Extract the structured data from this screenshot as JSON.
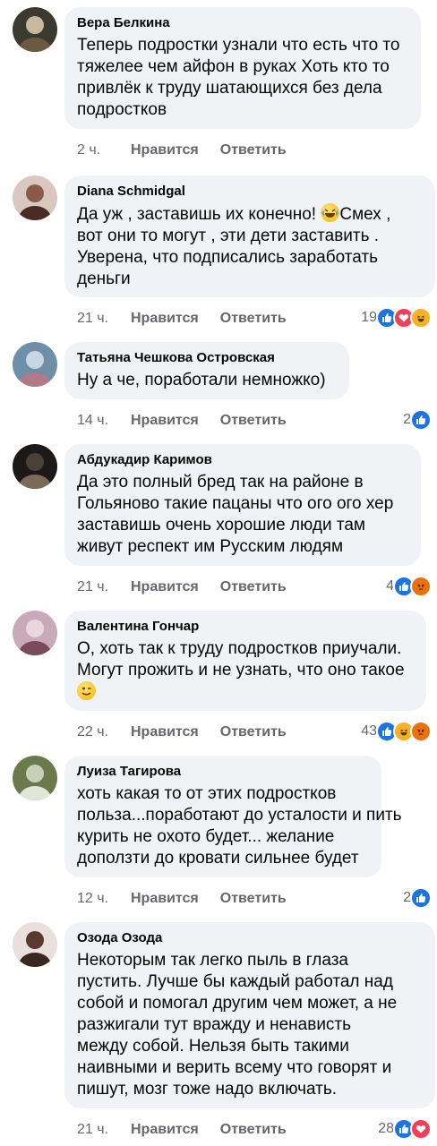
{
  "actions": {
    "like_label": "Нравится",
    "reply_label": "Ответить"
  },
  "comments": [
    {
      "author": "Вера Белкина",
      "lines": [
        "Теперь подростки узнали что есть что то",
        "тяжелее чем айфон в руках  Хоть кто то",
        "привлёк к труду шатающихся без дела",
        "подростков"
      ],
      "time": "2 ч.",
      "reaction_count": "",
      "reactions": []
    },
    {
      "author": "Diana Schmidgal",
      "lines": [
        "Да уж , заставишь их конечно! [laugh-emoji]Смех ,",
        "вот они то могут , эти дети заставить .",
        "Уверена, что подписались заработать",
        "деньги"
      ],
      "time": "21 ч.",
      "reaction_count": "19",
      "reactions": [
        "like",
        "love",
        "haha"
      ]
    },
    {
      "author": "Татьяна Чешкова Островская",
      "lines": [
        "Ну а че, поработали немножко)"
      ],
      "time": "14 ч.",
      "reaction_count": "2",
      "reactions": [
        "like"
      ]
    },
    {
      "author": "Абдукадир Каримов",
      "lines": [
        "Да это полный бред так на районе в",
        "Гольяново такие пацаны что ого ого хер",
        "заставишь очень хорошие люди там",
        "живут респект им Русским людям"
      ],
      "time": "21 ч.",
      "reaction_count": "4",
      "reactions": [
        "like",
        "angry"
      ]
    },
    {
      "author": "Валентина Гончар",
      "lines": [
        "О, хоть так к труду подростков приучали.",
        "Могут прожить и не узнать, что оно такое",
        "[wink-emoji]"
      ],
      "time": "22 ч.",
      "reaction_count": "43",
      "reactions": [
        "like",
        "haha",
        "angry"
      ]
    },
    {
      "author": "Луиза Тагирова",
      "lines": [
        "хоть какая то от этих подростков",
        "польза...поработают до усталости и пить",
        "курить не охото будет... желание",
        "доползти до кровати сильнее будет"
      ],
      "time": "12 ч.",
      "reaction_count": "2",
      "reactions": [
        "like"
      ]
    },
    {
      "author": "Озода Озода",
      "lines": [
        "Некоторым так легко пыль в глаза",
        "пустить. Лучше бы каждый работал над",
        "собой и помогал другим чем может, а не",
        "разжигали  тут вражду и ненависть",
        "между собой. Нельзя быть такими",
        "наивными и верить всему что говорят и",
        "пишут, мозг тоже надо включать."
      ],
      "time": "21 ч.",
      "reaction_count": "28",
      "reactions": [
        "like",
        "love"
      ]
    }
  ]
}
